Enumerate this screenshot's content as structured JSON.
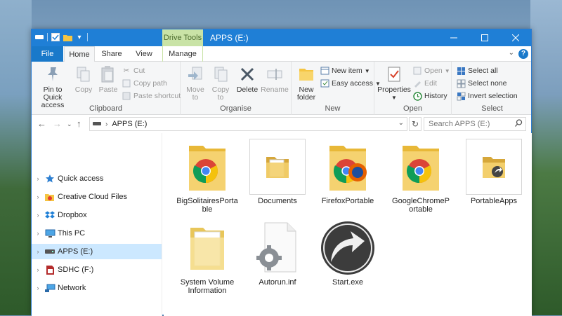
{
  "window": {
    "title": "APPS (E:)",
    "context_tab": "Drive Tools"
  },
  "tabs": [
    {
      "label": "File"
    },
    {
      "label": "Home"
    },
    {
      "label": "Share"
    },
    {
      "label": "View"
    },
    {
      "label": "Manage"
    }
  ],
  "ribbon": {
    "clipboard": {
      "label": "Clipboard",
      "pin_line1": "Pin to Quick",
      "pin_line2": "access",
      "copy": "Copy",
      "paste": "Paste",
      "cut": "Cut",
      "copy_path": "Copy path",
      "paste_shortcut": "Paste shortcut"
    },
    "organise": {
      "label": "Organise",
      "move_line1": "Move",
      "move_line2": "to",
      "copy_line1": "Copy",
      "copy_line2": "to",
      "delete": "Delete",
      "rename": "Rename"
    },
    "new": {
      "label": "New",
      "new_item": "New item",
      "easy_access": "Easy access",
      "new_folder_line1": "New",
      "new_folder_line2": "folder"
    },
    "open": {
      "label": "Open",
      "properties": "Properties",
      "open": "Open",
      "edit": "Edit",
      "history": "History"
    },
    "select": {
      "label": "Select",
      "select_all": "Select all",
      "select_none": "Select none",
      "invert_selection": "Invert selection"
    }
  },
  "address": {
    "path": "APPS (E:)",
    "search_placeholder": "Search APPS (E:)"
  },
  "nav": [
    {
      "label": "Quick access",
      "icon": "star-icon"
    },
    {
      "label": "Creative Cloud Files",
      "icon": "creative-cloud-icon"
    },
    {
      "label": "Dropbox",
      "icon": "dropbox-icon"
    },
    {
      "label": "This PC",
      "icon": "computer-icon"
    },
    {
      "label": "APPS (E:)",
      "icon": "drive-icon"
    },
    {
      "label": "SDHC (F:)",
      "icon": "sd-card-icon"
    },
    {
      "label": "Network",
      "icon": "network-icon"
    }
  ],
  "items": [
    {
      "line1": "BigSolitairesPorta",
      "line2": "ble",
      "icon": "chrome-folder-icon"
    },
    {
      "line1": "Documents",
      "line2": "",
      "icon": "folder-icon"
    },
    {
      "line1": "FirefoxPortable",
      "line2": "",
      "icon": "firefox-folder-icon"
    },
    {
      "line1": "GoogleChromeP",
      "line2": "ortable",
      "icon": "chrome-folder-icon"
    },
    {
      "line1": "PortableApps",
      "line2": "",
      "icon": "portableapps-folder-icon"
    },
    {
      "line1": "System Volume",
      "line2": "Information",
      "icon": "folder-icon"
    },
    {
      "line1": "Autorun.inf",
      "line2": "",
      "icon": "settings-file-icon"
    },
    {
      "line1": "Start.exe",
      "line2": "",
      "icon": "portableapps-start-icon"
    }
  ],
  "colors": {
    "titlebar": "#1f7fd6",
    "file_tab": "#1979ca",
    "context_tab": "#c9e3a6",
    "selection": "#cce8ff",
    "folder": "#f5c542"
  }
}
